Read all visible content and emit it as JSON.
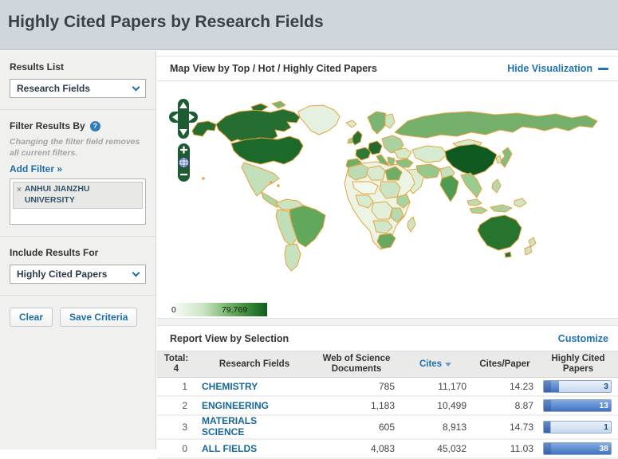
{
  "page": {
    "title": "Highly Cited Papers by Research Fields"
  },
  "sidebar": {
    "results_list": {
      "label": "Results List",
      "selected": "Research Fields"
    },
    "filter": {
      "label": "Filter Results By",
      "help_glyph": "?",
      "note": "Changing the filter field removes all current filters.",
      "add_filter_link": "Add Filter »",
      "active_filters": [
        {
          "remove_glyph": "×",
          "label": "ANHUI JIANZHU UNIVERSITY"
        }
      ]
    },
    "include_results": {
      "label": "Include Results For",
      "selected": "Highly Cited Papers"
    },
    "buttons": {
      "clear": "Clear",
      "save": "Save Criteria"
    }
  },
  "map_panel": {
    "title": "Map View by Top / Hot / Highly Cited Papers",
    "hide_link": "Hide Visualization",
    "scale": {
      "min": "0",
      "max": "79,769"
    },
    "colors": {
      "low": "#FFFFFF",
      "high": "#0D5E1D",
      "country_border": "#E8A33D"
    }
  },
  "report_panel": {
    "title": "Report View by Selection",
    "customize_link": "Customize",
    "table": {
      "total_label": "Total:",
      "total_value": "4",
      "columns": {
        "field": "Research Fields",
        "documents": "Web of Science Documents",
        "cites": "Cites",
        "cites_per_paper": "Cites/Paper",
        "highly_cited": "Highly Cited Papers"
      },
      "sorted_by": "Cites",
      "rows": [
        {
          "rank": "1",
          "field": "CHEMISTRY",
          "documents": "785",
          "cites": "11,170",
          "cites_per_paper": "14.23",
          "highly_cited": "3",
          "bar_pct": 23
        },
        {
          "rank": "2",
          "field": "ENGINEERING",
          "documents": "1,183",
          "cites": "10,499",
          "cites_per_paper": "8.87",
          "highly_cited": "13",
          "bar_pct": 100
        },
        {
          "rank": "3",
          "field": "MATERIALS SCIENCE",
          "documents": "605",
          "cites": "8,913",
          "cites_per_paper": "14.73",
          "highly_cited": "1",
          "bar_pct": 10
        },
        {
          "rank": "0",
          "field": "ALL FIELDS",
          "documents": "4,083",
          "cites": "45,032",
          "cites_per_paper": "11.03",
          "highly_cited": "38",
          "bar_pct": 100
        }
      ]
    }
  },
  "colors": {
    "accent_blue": "#1E73B0",
    "header_band": "#CFD7DD",
    "bar_fill": "#4273C1"
  }
}
